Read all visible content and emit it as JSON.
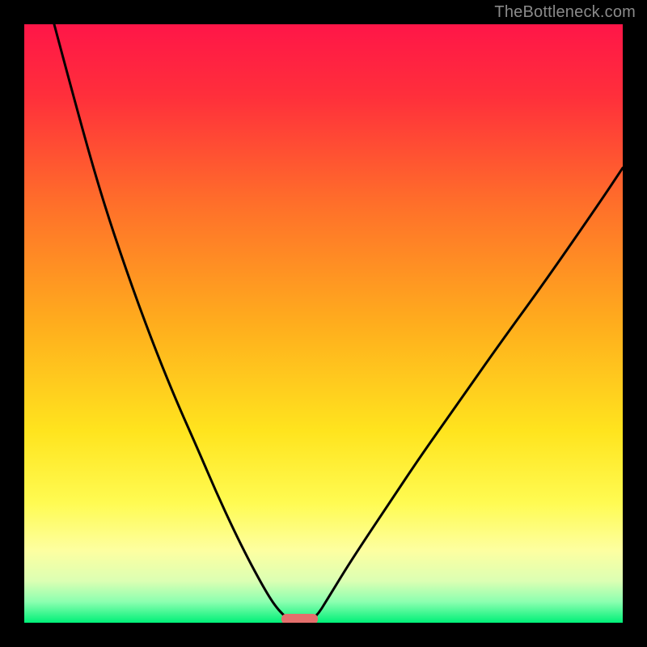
{
  "watermark": {
    "text": "TheBottleneck.com"
  },
  "chart_data": {
    "type": "line",
    "title": "",
    "xlabel": "",
    "ylabel": "",
    "xlim": [
      0,
      100
    ],
    "ylim": [
      0,
      100
    ],
    "grid": false,
    "legend": false,
    "gradient_stops": [
      {
        "offset": 0.0,
        "color": "#ff1648"
      },
      {
        "offset": 0.12,
        "color": "#ff2f3b"
      },
      {
        "offset": 0.3,
        "color": "#ff6f2a"
      },
      {
        "offset": 0.5,
        "color": "#ffad1d"
      },
      {
        "offset": 0.68,
        "color": "#ffe41e"
      },
      {
        "offset": 0.8,
        "color": "#fffb52"
      },
      {
        "offset": 0.88,
        "color": "#fdffa1"
      },
      {
        "offset": 0.93,
        "color": "#dcffb3"
      },
      {
        "offset": 0.965,
        "color": "#8cffb0"
      },
      {
        "offset": 1.0,
        "color": "#00f078"
      }
    ],
    "series": [
      {
        "name": "left-branch",
        "x": [
          5,
          9,
          13,
          17,
          21,
          25,
          29,
          32,
          35,
          37.5,
          39.5,
          41,
          42.2,
          43.2,
          43.8
        ],
        "y": [
          100,
          85,
          71,
          59,
          48,
          38,
          29,
          22,
          15.5,
          10.5,
          6.8,
          4.2,
          2.5,
          1.4,
          0.9
        ]
      },
      {
        "name": "right-branch",
        "x": [
          48.5,
          49.2,
          50.2,
          51.8,
          54,
          57,
          61,
          66,
          72,
          79,
          87,
          96,
          100
        ],
        "y": [
          0.9,
          1.6,
          3.2,
          5.8,
          9.4,
          14,
          20,
          27.5,
          36,
          46,
          57,
          70,
          76
        ]
      }
    ],
    "marker": {
      "x_start": 43.0,
      "x_end": 49.0,
      "y": 0.6,
      "height": 1.7,
      "color": "#e46f6c"
    },
    "curve_stroke": "#000000",
    "curve_width": 3
  }
}
